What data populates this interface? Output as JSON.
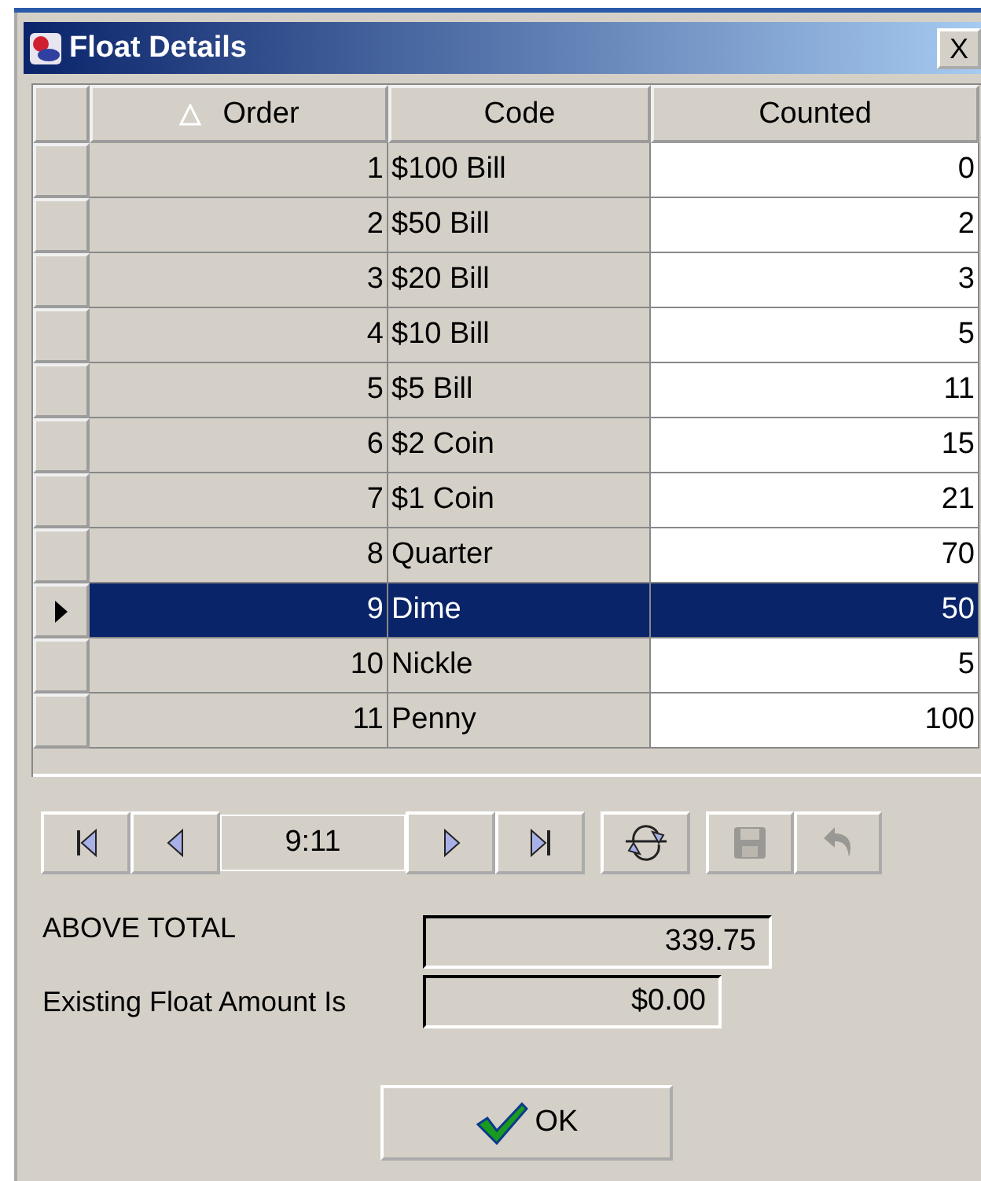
{
  "window": {
    "title": "Float Details",
    "close": "X"
  },
  "table": {
    "columns": [
      {
        "label": "Order",
        "sorted": true
      },
      {
        "label": "Code",
        "sorted": false
      },
      {
        "label": "Counted",
        "sorted": false
      }
    ],
    "rows": [
      {
        "order": "1",
        "code": "$100 Bill",
        "counted": "0",
        "selected": false
      },
      {
        "order": "2",
        "code": "$50 Bill",
        "counted": "2",
        "selected": false
      },
      {
        "order": "3",
        "code": "$20 Bill",
        "counted": "3",
        "selected": false
      },
      {
        "order": "4",
        "code": "$10 Bill",
        "counted": "5",
        "selected": false
      },
      {
        "order": "5",
        "code": "$5 Bill",
        "counted": "11",
        "selected": false
      },
      {
        "order": "6",
        "code": "$2 Coin",
        "counted": "15",
        "selected": false
      },
      {
        "order": "7",
        "code": "$1 Coin",
        "counted": "21",
        "selected": false
      },
      {
        "order": "8",
        "code": "Quarter",
        "counted": "70",
        "selected": false
      },
      {
        "order": "9",
        "code": "Dime",
        "counted": "50",
        "selected": true
      },
      {
        "order": "10",
        "code": "Nickle",
        "counted": "5",
        "selected": false
      },
      {
        "order": "11",
        "code": "Penny",
        "counted": "100",
        "selected": false
      }
    ]
  },
  "navigator": {
    "position": "9:11",
    "buttons": [
      {
        "kind": "first",
        "disabled": false
      },
      {
        "kind": "prev",
        "disabled": false
      },
      {
        "kind": "position"
      },
      {
        "kind": "next",
        "disabled": false
      },
      {
        "kind": "last",
        "disabled": false
      },
      {
        "kind": "refresh",
        "disabled": false
      },
      {
        "kind": "save",
        "disabled": true
      },
      {
        "kind": "undo",
        "disabled": true
      }
    ]
  },
  "fields": [
    {
      "label": "ABOVE TOTAL",
      "value": "339.75"
    },
    {
      "label": "Existing Float Amount Is",
      "value": "$0.00"
    }
  ],
  "ok_button": "OK"
}
